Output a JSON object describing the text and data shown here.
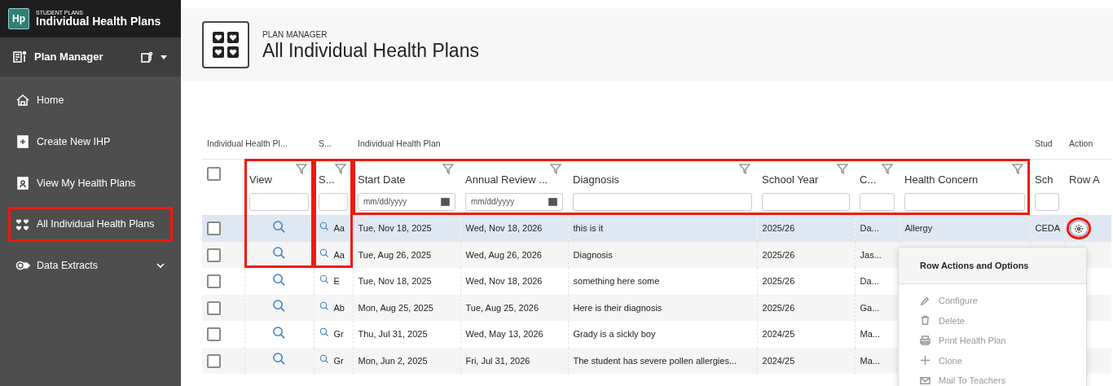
{
  "app": {
    "logo": "Hp",
    "suite": "STUDENT PLANS",
    "title": "Individual Health Plans"
  },
  "module": {
    "title": "Plan Manager"
  },
  "sidebar": {
    "items": [
      {
        "label": "Home",
        "kind": "home",
        "highlighted": false
      },
      {
        "label": "Create New IHP",
        "kind": "create",
        "highlighted": false
      },
      {
        "label": "View My Health Plans",
        "kind": "view",
        "highlighted": false
      },
      {
        "label": "All Individual Health Plans",
        "kind": "hearts",
        "highlighted": true
      },
      {
        "label": "Data Extracts",
        "kind": "extract",
        "highlighted": false,
        "expanded": false
      }
    ]
  },
  "page": {
    "overline": "PLAN MANAGER",
    "title": "All Individual Health Plans"
  },
  "table": {
    "groups": [
      {
        "label": "Individual Health Pl...",
        "columns": [
          {
            "kind": "checkbox",
            "checked": false
          },
          {
            "kind": "view",
            "label": "View",
            "filterable": true,
            "filter_field": true,
            "highlighted": true,
            "highlight_covers_rows": true
          }
        ]
      },
      {
        "label": "S...",
        "columns": [
          {
            "kind": "student",
            "label": "S...",
            "filterable": true,
            "filter_field": true,
            "highlighted": true,
            "highlight_covers_rows": true
          }
        ]
      },
      {
        "label": "Individual Health Plan",
        "columns_highlighted": true,
        "columns": [
          {
            "kind": "start_date",
            "label": "Start Date",
            "filterable": true,
            "filter_field": true,
            "placeholder": "mm/dd/yyyy"
          },
          {
            "kind": "annual_review",
            "label": "Annual Review ...",
            "filterable": true,
            "filter_field": true,
            "placeholder": "mm/dd/yyyy"
          },
          {
            "kind": "diagnosis",
            "label": "Diagnosis",
            "filterable": true,
            "filter_field": true
          },
          {
            "kind": "school_year",
            "label": "School Year",
            "filterable": true,
            "filter_field": true
          },
          {
            "kind": "c",
            "label": "C...",
            "filterable": true,
            "filter_field": true
          },
          {
            "kind": "health_concern",
            "label": "Health Concern",
            "filterable": true,
            "filter_field": true
          }
        ]
      },
      {
        "label": "Stud",
        "columns": [
          {
            "kind": "school",
            "label": "Sch",
            "filterable": false,
            "filter_field": true
          }
        ]
      },
      {
        "label": "Action",
        "columns": [
          {
            "kind": "actions",
            "label": "Row A",
            "filterable": false
          }
        ]
      }
    ],
    "rows": [
      {
        "selected": true,
        "checked": false,
        "student": "Aa",
        "start_date": "Tue, Nov 18, 2025",
        "annual_review": "Wed, Nov 18, 2026",
        "diagnosis": "this is it",
        "school_year": "2025/26",
        "c": "Da...",
        "health_concern": "Allergy",
        "school": "CEDA",
        "actions": {
          "circled": true
        }
      },
      {
        "selected": false,
        "checked": false,
        "student": "Aa",
        "start_date": "Tue, Aug 26, 2025",
        "annual_review": "Wed, Aug 26, 2026",
        "diagnosis": "Diagnosis",
        "school_year": "2025/26",
        "c": "Jas..."
      },
      {
        "selected": false,
        "checked": false,
        "student": "E",
        "start_date": "Tue, Nov 18, 2025",
        "annual_review": "Wed, Nov 18, 2026",
        "diagnosis": "something here some",
        "school_year": "2025/26",
        "c": "Da..."
      },
      {
        "selected": false,
        "checked": false,
        "student": "Ab",
        "start_date": "Mon, Aug 25, 2025",
        "annual_review": "Tue, Aug 25, 2026",
        "diagnosis": "Here is their diagnosis",
        "school_year": "2025/26",
        "c": "Ga..."
      },
      {
        "selected": false,
        "checked": false,
        "student": "Gr",
        "start_date": "Thu, Jul 31, 2025",
        "annual_review": "Wed, May 13, 2026",
        "diagnosis": "Grady is a sickly boy",
        "school_year": "2024/25",
        "c": "Ma..."
      },
      {
        "selected": false,
        "checked": false,
        "student": "Gr",
        "start_date": "Mon, Jun 2, 2025",
        "annual_review": "Fri, Jul 31, 2026",
        "diagnosis": "The student has severe pollen allergies...",
        "school_year": "2024/25",
        "c": "Ma..."
      }
    ]
  },
  "row_menu": {
    "title": "Row Actions and Options",
    "items": [
      {
        "label": "Configure",
        "kind": "pencil",
        "disabled": true
      },
      {
        "label": "Delete",
        "kind": "trash",
        "disabled": true
      },
      {
        "label": "Print Health Plan",
        "kind": "printer",
        "disabled": true
      },
      {
        "label": "Clone",
        "kind": "plus",
        "disabled": true
      },
      {
        "label": "Mail To Teachers",
        "kind": "envelope",
        "disabled": true
      }
    ]
  }
}
